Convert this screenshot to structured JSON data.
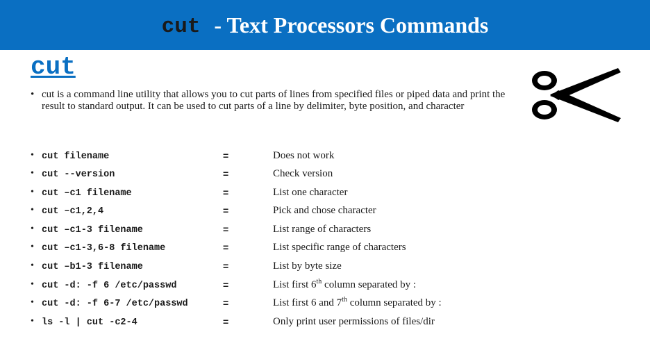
{
  "header": {
    "command": "cut",
    "title": "- Text Processors Commands"
  },
  "heading": "cut",
  "intro": {
    "bullet": "•",
    "text": "cut is a command line utility that allows you to cut parts of lines from specified files or piped data and print the result to standard output. It can be used to cut parts of a line by delimiter, byte position, and character"
  },
  "image": {
    "icon": "scissors-icon"
  },
  "commands": [
    {
      "bullet": "•",
      "cmd": "cut filename",
      "eq": "=",
      "desc": "Does not work"
    },
    {
      "bullet": "•",
      "cmd": "cut --version",
      "eq": "=",
      "desc": "Check version"
    },
    {
      "bullet": "•",
      "cmd": "cut –c1 filename",
      "eq": "=",
      "desc": "List one character"
    },
    {
      "bullet": "•",
      "cmd": "cut –c1,2,4",
      "eq": "=",
      "desc": "Pick and chose character"
    },
    {
      "bullet": "•",
      "cmd": "cut –c1-3 filename",
      "eq": "=",
      "desc": "List range of characters"
    },
    {
      "bullet": "•",
      "cmd": "cut –c1-3,6-8 filename",
      "eq": "=",
      "desc": "List specific range of characters"
    },
    {
      "bullet": "•",
      "cmd": "cut –b1-3 filename",
      "eq": "=",
      "desc": "List by byte size"
    },
    {
      "bullet": "•",
      "cmd": "cut -d: -f 6 /etc/passwd",
      "eq": "=",
      "desc_pre": "List first 6",
      "desc_sup": "th",
      "desc_post": " column separated by :"
    },
    {
      "bullet": "•",
      "cmd": "cut -d: -f 6-7 /etc/passwd",
      "eq": "=",
      "desc_pre": "List first 6 and 7",
      "desc_sup": "th",
      "desc_post": " column separated by :"
    },
    {
      "bullet": "•",
      "cmd": "ls -l | cut -c2-4",
      "eq": "=",
      "desc": "Only print user permissions of files/dir"
    }
  ]
}
